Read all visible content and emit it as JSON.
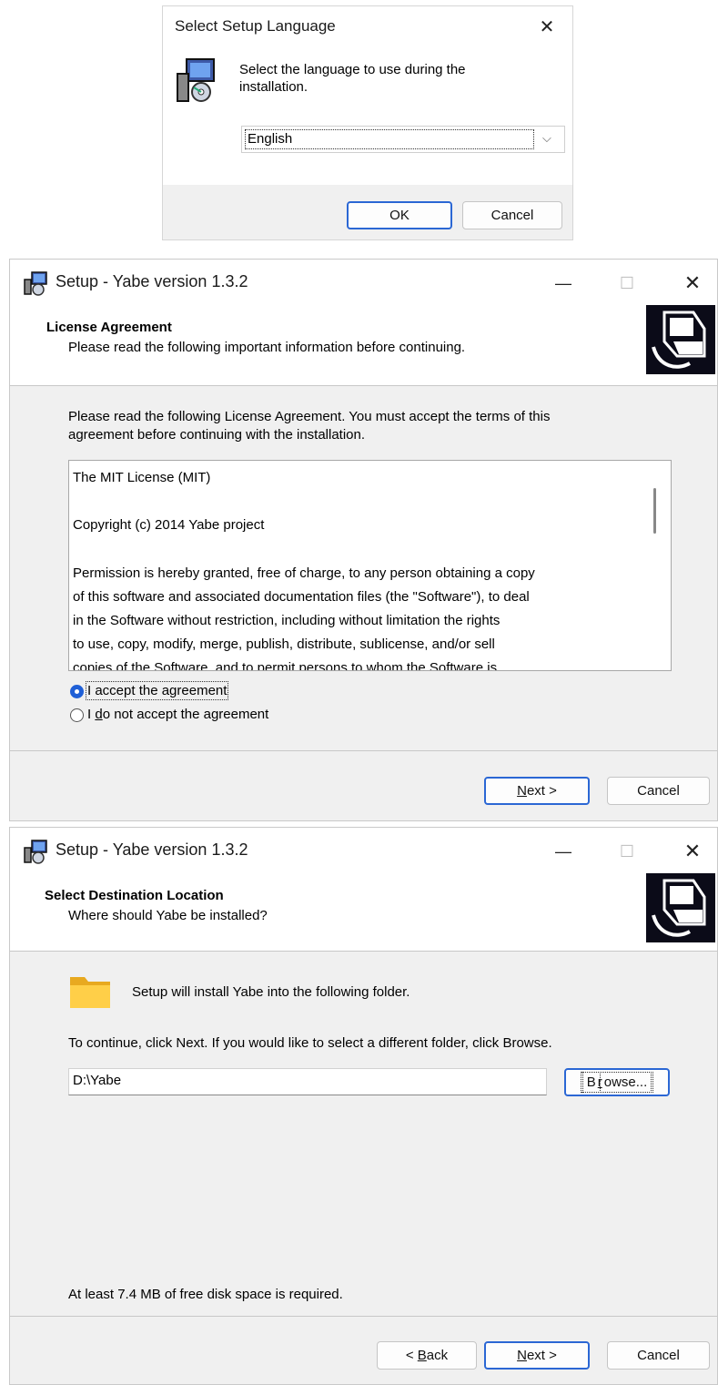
{
  "lang_dialog": {
    "title": "Select Setup Language",
    "close_glyph": "✕",
    "message": "Select the language to use during the installation.",
    "selected_language": "English",
    "ok_label": "OK",
    "cancel_label": "Cancel",
    "icon": "setup-cd-computer-icon"
  },
  "license_window": {
    "title": "Setup - Yabe version 1.3.2",
    "header_title": "License Agreement",
    "header_subtitle": "Please read the following important information before continuing.",
    "instruction_line1": "Please read the following License Agreement. You must accept the terms of this",
    "instruction_line2": "agreement before continuing with the installation.",
    "license_lines": [
      "The MIT License (MIT)",
      "",
      "Copyright (c) 2014 Yabe project",
      "",
      "Permission is hereby granted, free of charge, to any person obtaining a copy",
      "of this software and associated documentation files (the \"Software\"), to deal",
      "in the Software without restriction, including without limitation the rights",
      "to use, copy, modify, merge, publish, distribute, sublicense, and/or sell",
      "copies of the Software, and to permit persons to whom the Software is"
    ],
    "accept_label": "I accept the agreement",
    "decline_label_pre": "I ",
    "decline_label_u": "d",
    "decline_label_post": "o not accept the agreement",
    "accept_selected": true,
    "next_label_u": "N",
    "next_label_rest": "ext >",
    "cancel_label": "Cancel"
  },
  "destination_window": {
    "title": "Setup - Yabe version 1.3.2",
    "header_title": "Select Destination Location",
    "header_subtitle": "Where should Yabe be installed?",
    "folder_message": "Setup will install Yabe into the following folder.",
    "instruction": "To continue, click Next. If you would like to select a different folder, click Browse.",
    "path_value": "D:\\Yabe",
    "browse_label_u": "r",
    "browse_label_pre": "B",
    "browse_label_post": "owse...",
    "disk_space": "At least 7.4 MB of free disk space is required.",
    "back_label_pre": "< ",
    "back_label_u": "B",
    "back_label_post": "ack",
    "next_label_u": "N",
    "next_label_rest": "ext >",
    "cancel_label": "Cancel"
  },
  "window_controls": {
    "minimize_glyph": "—",
    "maximize_glyph": "☐",
    "close_glyph": "✕"
  },
  "colors": {
    "accent": "#1f5fd6",
    "button_default_border": "#2b67d4",
    "footer_gray": "#f0f0f0"
  }
}
